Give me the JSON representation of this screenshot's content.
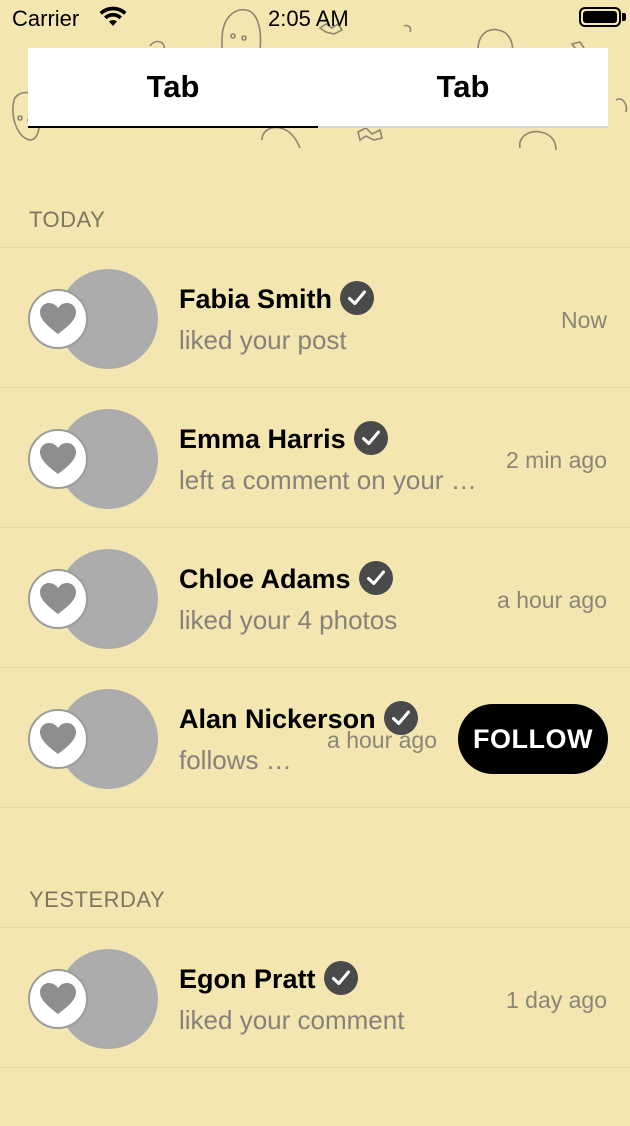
{
  "status_bar": {
    "carrier": "Carrier",
    "time": "2:05 AM"
  },
  "tabs": [
    {
      "label": "Tab",
      "active": true
    },
    {
      "label": "Tab",
      "active": false
    }
  ],
  "sections": [
    {
      "title": "TODAY",
      "items": [
        {
          "name": "Fabia Smith",
          "subtitle": "liked your post",
          "time": "Now",
          "verified": true
        },
        {
          "name": "Emma Harris",
          "subtitle": "left a comment on your photo",
          "time": "2 min ago",
          "verified": true
        },
        {
          "name": "Chloe Adams",
          "subtitle": "liked your 4 photos",
          "time": "a hour ago",
          "verified": true
        },
        {
          "name": "Alan Nickerson",
          "subtitle": "follows you",
          "time": "a hour ago",
          "verified": true,
          "action": "FOLLOW"
        }
      ]
    },
    {
      "title": "YESTERDAY",
      "items": [
        {
          "name": "Egon Pratt",
          "subtitle": "liked your comment",
          "time": "1 day ago",
          "verified": true
        }
      ]
    }
  ],
  "colors": {
    "background": "#f3e6b0",
    "avatar": "#acacac",
    "check_badge": "#4a4a4a",
    "heart": "#8e8e8e"
  }
}
